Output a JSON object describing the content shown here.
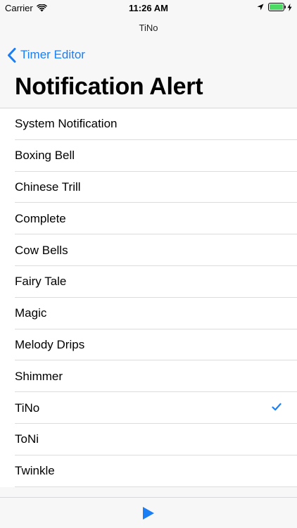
{
  "status_bar": {
    "carrier": "Carrier",
    "time": "11:26 AM",
    "icons": [
      "wifi-icon",
      "location-icon",
      "battery-icon",
      "charging-icon"
    ]
  },
  "header": {
    "app_name": "TiNo",
    "back_label": "Timer Editor",
    "title": "Notification Alert"
  },
  "colors": {
    "accent": "#1a7ef5",
    "battery": "#4cd964"
  },
  "alerts": [
    {
      "label": "System Notification",
      "selected": false
    },
    {
      "label": "Boxing Bell",
      "selected": false
    },
    {
      "label": "Chinese Trill",
      "selected": false
    },
    {
      "label": "Complete",
      "selected": false
    },
    {
      "label": "Cow Bells",
      "selected": false
    },
    {
      "label": "Fairy Tale",
      "selected": false
    },
    {
      "label": "Magic",
      "selected": false
    },
    {
      "label": "Melody Drips",
      "selected": false
    },
    {
      "label": "Shimmer",
      "selected": false
    },
    {
      "label": "TiNo",
      "selected": true
    },
    {
      "label": "ToNi",
      "selected": false
    },
    {
      "label": "Twinkle",
      "selected": false
    }
  ],
  "toolbar": {
    "play_icon": "play-icon"
  }
}
